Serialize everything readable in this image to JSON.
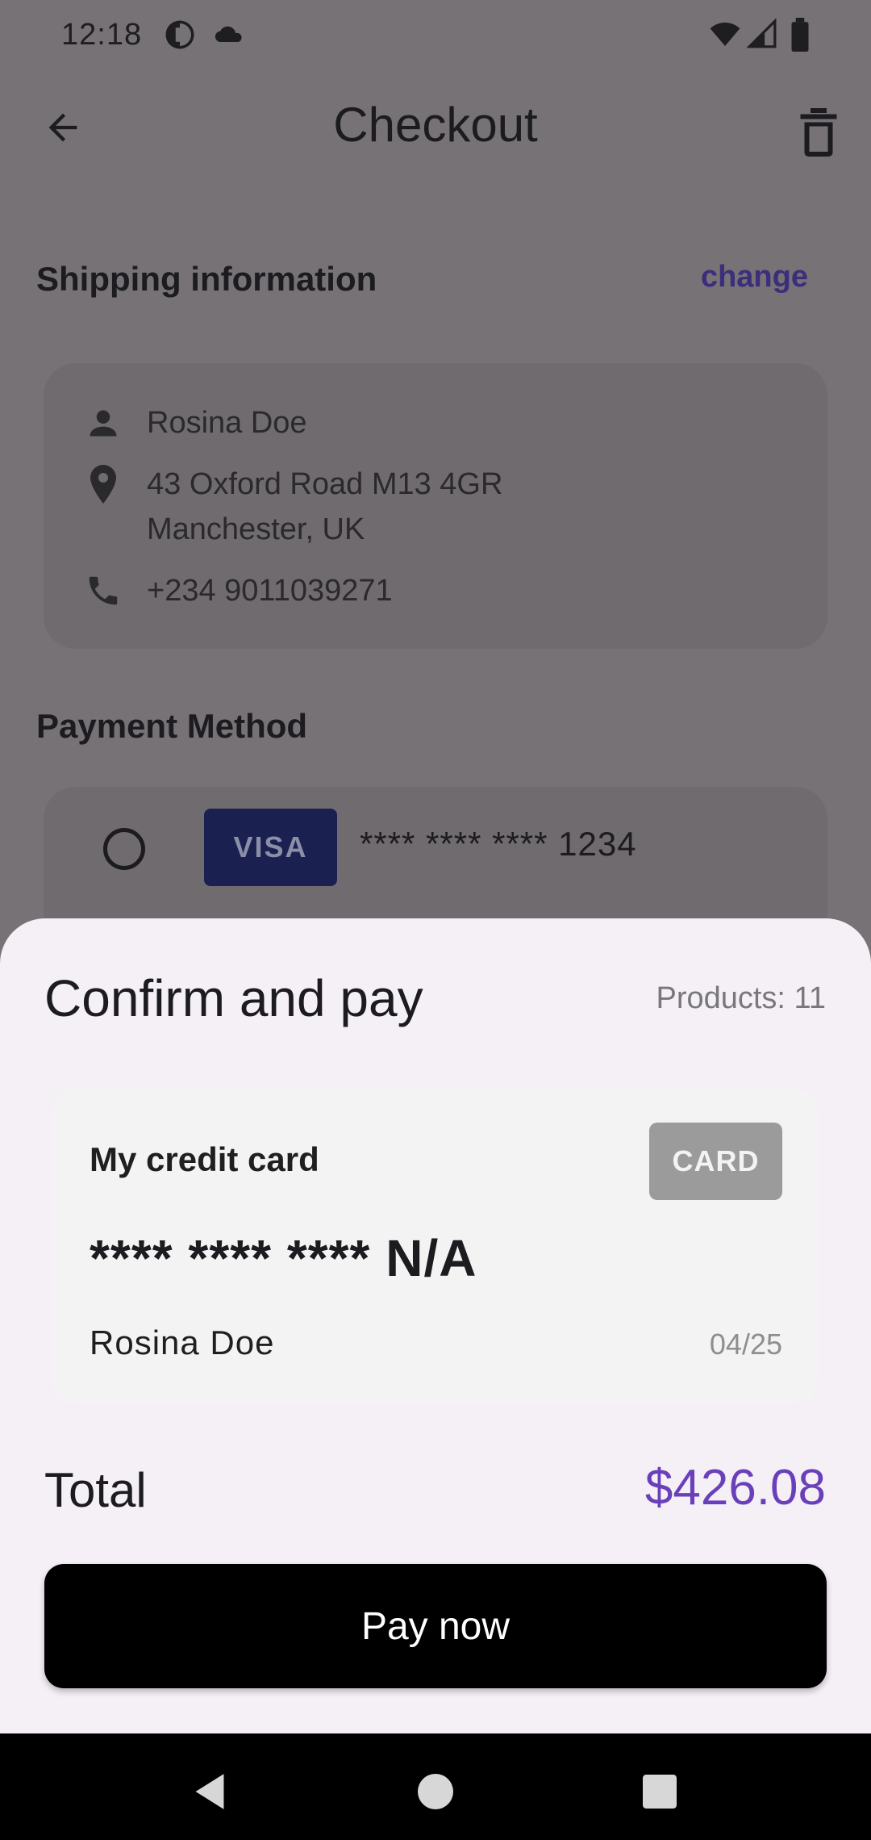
{
  "status_bar": {
    "time": "12:18"
  },
  "app_bar": {
    "title": "Checkout"
  },
  "shipping": {
    "section_label": "Shipping information",
    "change_label": "change",
    "name": "Rosina Doe",
    "address_line1": "43 Oxford Road M13 4GR",
    "address_line2": "Manchester, UK",
    "phone": "+234 9011039271"
  },
  "payment": {
    "section_label": "Payment Method",
    "visa_badge": "VISA",
    "masked_number": "**** **** **** 1234"
  },
  "sheet": {
    "title": "Confirm and pay",
    "products": "Products: 11",
    "card": {
      "label": "My credit card",
      "badge": "CARD",
      "number": "**** **** **** N/A",
      "holder": "Rosina Doe",
      "expiry": "04/25"
    },
    "total_label": "Total",
    "total_value": "$426.08",
    "pay_button": "Pay now"
  },
  "colors": {
    "accent": "#6a3fba",
    "scrim": "#767275",
    "sheet": "#f4f0f6"
  }
}
